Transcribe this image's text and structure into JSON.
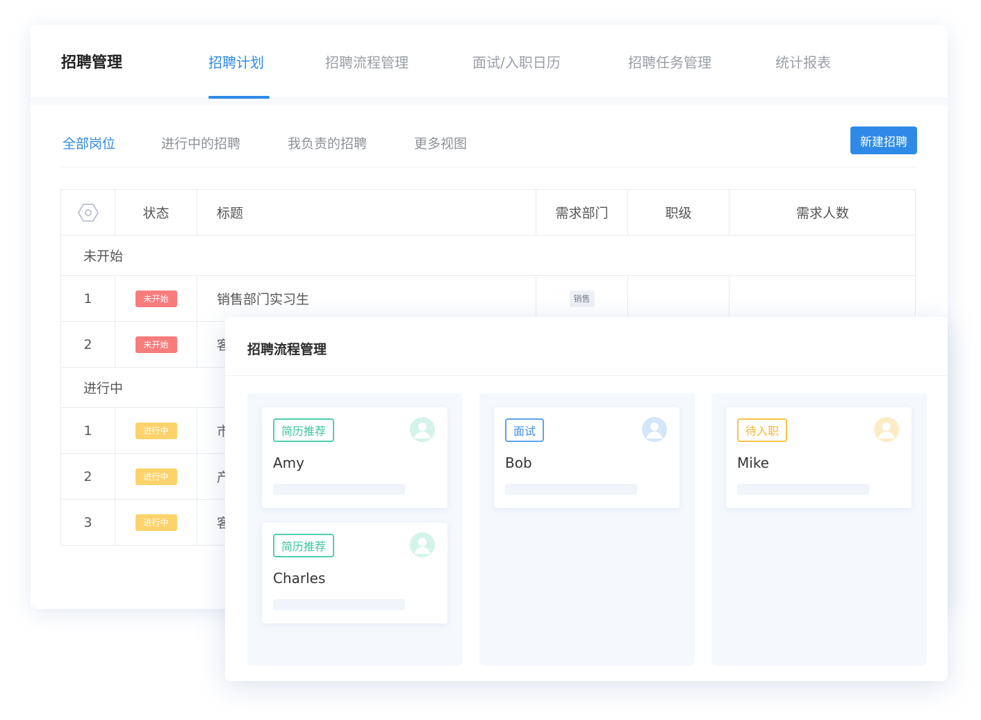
{
  "app": {
    "title": "招聘管理"
  },
  "top_tabs": [
    {
      "label": "招聘计划",
      "active": true
    },
    {
      "label": "招聘流程管理",
      "active": false
    },
    {
      "label": "面试/入职日历",
      "active": false
    },
    {
      "label": "招聘任务管理",
      "active": false
    },
    {
      "label": "统计报表",
      "active": false
    }
  ],
  "sub_tabs": [
    {
      "label": "全部岗位",
      "active": true
    },
    {
      "label": "进行中的招聘",
      "active": false
    },
    {
      "label": "我负责的招聘",
      "active": false
    },
    {
      "label": "更多视图",
      "active": false
    }
  ],
  "toolbar": {
    "new_button": "新建招聘"
  },
  "table": {
    "settings_icon": "hexagon-settings-icon",
    "columns": [
      "状态",
      "标题",
      "需求部门",
      "职级",
      "需求人数"
    ],
    "groups": [
      {
        "label": "未开始",
        "rows": [
          {
            "index": "1",
            "status": "未开始",
            "title": "销售部门实习生",
            "dept": "销售"
          },
          {
            "index": "2",
            "status": "未开始",
            "title": "客",
            "dept": ""
          }
        ]
      },
      {
        "label": "进行中",
        "rows": [
          {
            "index": "1",
            "status": "进行中",
            "title": "市",
            "dept": ""
          },
          {
            "index": "2",
            "status": "进行中",
            "title": "产",
            "dept": ""
          },
          {
            "index": "3",
            "status": "进行中",
            "title": "客",
            "dept": ""
          }
        ]
      }
    ]
  },
  "overlay": {
    "title": "招聘流程管理",
    "lanes": [
      {
        "cards": [
          {
            "stage": "简历推荐",
            "name": "Amy"
          },
          {
            "stage": "简历推荐",
            "name": "Charles"
          }
        ]
      },
      {
        "cards": [
          {
            "stage": "面试",
            "name": "Bob"
          }
        ]
      },
      {
        "cards": [
          {
            "stage": "待入职",
            "name": "Mike"
          }
        ]
      }
    ]
  },
  "colors": {
    "accent": "#2e8ae6",
    "status_not_started": "#f87c7c",
    "status_in_progress": "#fcd36b",
    "stage_resume": "#3cc6a0",
    "stage_interview": "#3f91e8",
    "stage_onboarding": "#f5b731"
  }
}
